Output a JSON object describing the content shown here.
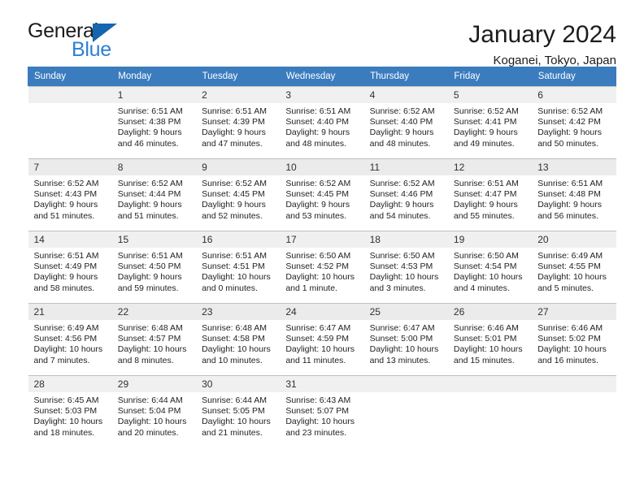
{
  "brand": {
    "name_part1": "General",
    "name_part2": "Blue",
    "accent_color": "#2e7fd4",
    "triangle_color": "#1565b0"
  },
  "header": {
    "title": "January 2024",
    "location": "Koganei, Tokyo, Japan"
  },
  "calendar": {
    "header_bg": "#3a7cbe",
    "weekdays": [
      "Sunday",
      "Monday",
      "Tuesday",
      "Wednesday",
      "Thursday",
      "Friday",
      "Saturday"
    ],
    "weeks": [
      [
        {
          "day": "",
          "sunrise": "",
          "sunset": "",
          "daylight1": "",
          "daylight2": ""
        },
        {
          "day": "1",
          "sunrise": "Sunrise: 6:51 AM",
          "sunset": "Sunset: 4:38 PM",
          "daylight1": "Daylight: 9 hours",
          "daylight2": "and 46 minutes."
        },
        {
          "day": "2",
          "sunrise": "Sunrise: 6:51 AM",
          "sunset": "Sunset: 4:39 PM",
          "daylight1": "Daylight: 9 hours",
          "daylight2": "and 47 minutes."
        },
        {
          "day": "3",
          "sunrise": "Sunrise: 6:51 AM",
          "sunset": "Sunset: 4:40 PM",
          "daylight1": "Daylight: 9 hours",
          "daylight2": "and 48 minutes."
        },
        {
          "day": "4",
          "sunrise": "Sunrise: 6:52 AM",
          "sunset": "Sunset: 4:40 PM",
          "daylight1": "Daylight: 9 hours",
          "daylight2": "and 48 minutes."
        },
        {
          "day": "5",
          "sunrise": "Sunrise: 6:52 AM",
          "sunset": "Sunset: 4:41 PM",
          "daylight1": "Daylight: 9 hours",
          "daylight2": "and 49 minutes."
        },
        {
          "day": "6",
          "sunrise": "Sunrise: 6:52 AM",
          "sunset": "Sunset: 4:42 PM",
          "daylight1": "Daylight: 9 hours",
          "daylight2": "and 50 minutes."
        }
      ],
      [
        {
          "day": "7",
          "sunrise": "Sunrise: 6:52 AM",
          "sunset": "Sunset: 4:43 PM",
          "daylight1": "Daylight: 9 hours",
          "daylight2": "and 51 minutes."
        },
        {
          "day": "8",
          "sunrise": "Sunrise: 6:52 AM",
          "sunset": "Sunset: 4:44 PM",
          "daylight1": "Daylight: 9 hours",
          "daylight2": "and 51 minutes."
        },
        {
          "day": "9",
          "sunrise": "Sunrise: 6:52 AM",
          "sunset": "Sunset: 4:45 PM",
          "daylight1": "Daylight: 9 hours",
          "daylight2": "and 52 minutes."
        },
        {
          "day": "10",
          "sunrise": "Sunrise: 6:52 AM",
          "sunset": "Sunset: 4:45 PM",
          "daylight1": "Daylight: 9 hours",
          "daylight2": "and 53 minutes."
        },
        {
          "day": "11",
          "sunrise": "Sunrise: 6:52 AM",
          "sunset": "Sunset: 4:46 PM",
          "daylight1": "Daylight: 9 hours",
          "daylight2": "and 54 minutes."
        },
        {
          "day": "12",
          "sunrise": "Sunrise: 6:51 AM",
          "sunset": "Sunset: 4:47 PM",
          "daylight1": "Daylight: 9 hours",
          "daylight2": "and 55 minutes."
        },
        {
          "day": "13",
          "sunrise": "Sunrise: 6:51 AM",
          "sunset": "Sunset: 4:48 PM",
          "daylight1": "Daylight: 9 hours",
          "daylight2": "and 56 minutes."
        }
      ],
      [
        {
          "day": "14",
          "sunrise": "Sunrise: 6:51 AM",
          "sunset": "Sunset: 4:49 PM",
          "daylight1": "Daylight: 9 hours",
          "daylight2": "and 58 minutes."
        },
        {
          "day": "15",
          "sunrise": "Sunrise: 6:51 AM",
          "sunset": "Sunset: 4:50 PM",
          "daylight1": "Daylight: 9 hours",
          "daylight2": "and 59 minutes."
        },
        {
          "day": "16",
          "sunrise": "Sunrise: 6:51 AM",
          "sunset": "Sunset: 4:51 PM",
          "daylight1": "Daylight: 10 hours",
          "daylight2": "and 0 minutes."
        },
        {
          "day": "17",
          "sunrise": "Sunrise: 6:50 AM",
          "sunset": "Sunset: 4:52 PM",
          "daylight1": "Daylight: 10 hours",
          "daylight2": "and 1 minute."
        },
        {
          "day": "18",
          "sunrise": "Sunrise: 6:50 AM",
          "sunset": "Sunset: 4:53 PM",
          "daylight1": "Daylight: 10 hours",
          "daylight2": "and 3 minutes."
        },
        {
          "day": "19",
          "sunrise": "Sunrise: 6:50 AM",
          "sunset": "Sunset: 4:54 PM",
          "daylight1": "Daylight: 10 hours",
          "daylight2": "and 4 minutes."
        },
        {
          "day": "20",
          "sunrise": "Sunrise: 6:49 AM",
          "sunset": "Sunset: 4:55 PM",
          "daylight1": "Daylight: 10 hours",
          "daylight2": "and 5 minutes."
        }
      ],
      [
        {
          "day": "21",
          "sunrise": "Sunrise: 6:49 AM",
          "sunset": "Sunset: 4:56 PM",
          "daylight1": "Daylight: 10 hours",
          "daylight2": "and 7 minutes."
        },
        {
          "day": "22",
          "sunrise": "Sunrise: 6:48 AM",
          "sunset": "Sunset: 4:57 PM",
          "daylight1": "Daylight: 10 hours",
          "daylight2": "and 8 minutes."
        },
        {
          "day": "23",
          "sunrise": "Sunrise: 6:48 AM",
          "sunset": "Sunset: 4:58 PM",
          "daylight1": "Daylight: 10 hours",
          "daylight2": "and 10 minutes."
        },
        {
          "day": "24",
          "sunrise": "Sunrise: 6:47 AM",
          "sunset": "Sunset: 4:59 PM",
          "daylight1": "Daylight: 10 hours",
          "daylight2": "and 11 minutes."
        },
        {
          "day": "25",
          "sunrise": "Sunrise: 6:47 AM",
          "sunset": "Sunset: 5:00 PM",
          "daylight1": "Daylight: 10 hours",
          "daylight2": "and 13 minutes."
        },
        {
          "day": "26",
          "sunrise": "Sunrise: 6:46 AM",
          "sunset": "Sunset: 5:01 PM",
          "daylight1": "Daylight: 10 hours",
          "daylight2": "and 15 minutes."
        },
        {
          "day": "27",
          "sunrise": "Sunrise: 6:46 AM",
          "sunset": "Sunset: 5:02 PM",
          "daylight1": "Daylight: 10 hours",
          "daylight2": "and 16 minutes."
        }
      ],
      [
        {
          "day": "28",
          "sunrise": "Sunrise: 6:45 AM",
          "sunset": "Sunset: 5:03 PM",
          "daylight1": "Daylight: 10 hours",
          "daylight2": "and 18 minutes."
        },
        {
          "day": "29",
          "sunrise": "Sunrise: 6:44 AM",
          "sunset": "Sunset: 5:04 PM",
          "daylight1": "Daylight: 10 hours",
          "daylight2": "and 20 minutes."
        },
        {
          "day": "30",
          "sunrise": "Sunrise: 6:44 AM",
          "sunset": "Sunset: 5:05 PM",
          "daylight1": "Daylight: 10 hours",
          "daylight2": "and 21 minutes."
        },
        {
          "day": "31",
          "sunrise": "Sunrise: 6:43 AM",
          "sunset": "Sunset: 5:07 PM",
          "daylight1": "Daylight: 10 hours",
          "daylight2": "and 23 minutes."
        },
        {
          "day": "",
          "sunrise": "",
          "sunset": "",
          "daylight1": "",
          "daylight2": ""
        },
        {
          "day": "",
          "sunrise": "",
          "sunset": "",
          "daylight1": "",
          "daylight2": ""
        },
        {
          "day": "",
          "sunrise": "",
          "sunset": "",
          "daylight1": "",
          "daylight2": ""
        }
      ]
    ]
  }
}
